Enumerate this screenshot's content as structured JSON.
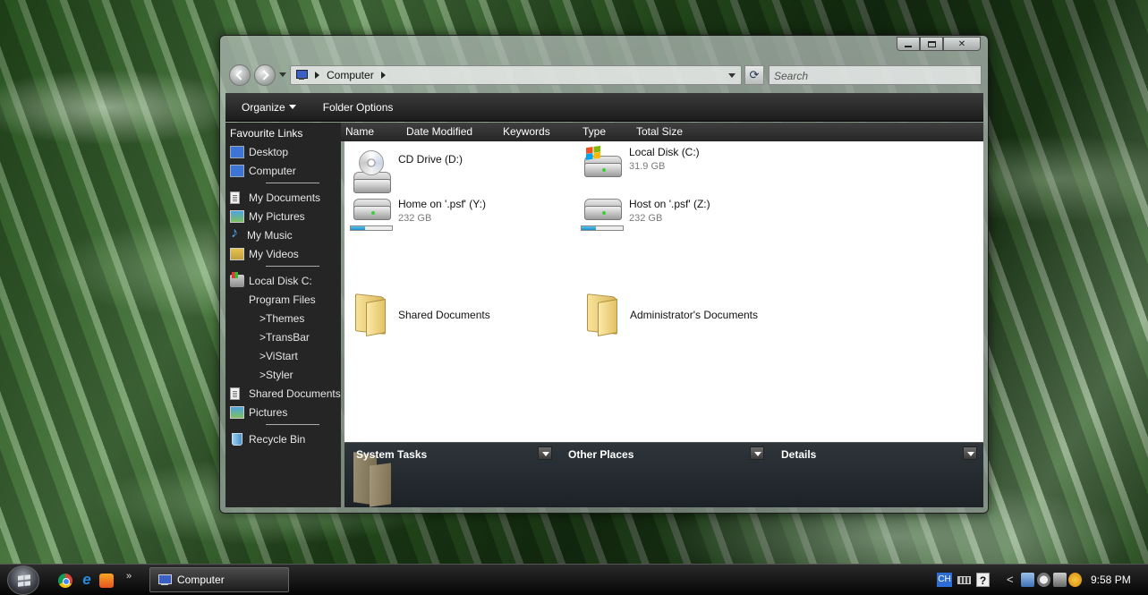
{
  "window": {
    "caption_buttons": [
      "minimize-icon",
      "maximize-icon",
      "close-icon"
    ],
    "close_glyph": "✕"
  },
  "navbar": {
    "address_crumb": "Computer",
    "search_placeholder": "Search",
    "refresh_glyph": "⟳"
  },
  "toolbar": {
    "organize": "Organize",
    "folder_options": "Folder Options"
  },
  "sidebar": {
    "title": "Favourite Links",
    "items": [
      {
        "label": "Desktop",
        "icon": "desktop-icon"
      },
      {
        "label": "Computer",
        "icon": "computer-icon"
      },
      {
        "label": "My Documents",
        "icon": "documents-icon"
      },
      {
        "label": "My Pictures",
        "icon": "pictures-icon"
      },
      {
        "label": "My Music",
        "icon": "music-icon"
      },
      {
        "label": "My Videos",
        "icon": "videos-icon"
      },
      {
        "label": "Local Disk C:",
        "icon": "local-disk-icon"
      },
      {
        "label": "Program Files"
      },
      {
        "label": ">Themes"
      },
      {
        "label": ">TransBar"
      },
      {
        "label": ">ViStart"
      },
      {
        "label": ">Styler"
      },
      {
        "label": "Shared Documents",
        "icon": "documents-icon"
      },
      {
        "label": "Pictures",
        "icon": "pictures-icon"
      },
      {
        "label": "Recycle Bin",
        "icon": "recycle-bin-icon"
      }
    ]
  },
  "columns": [
    "Name",
    "Date Modified",
    "Keywords",
    "Type",
    "Total Size"
  ],
  "items": [
    {
      "name": "CD Drive (D:)",
      "detail": "",
      "icon": "cd-drive-icon"
    },
    {
      "name": "Local Disk (C:)",
      "detail": "31.9 GB",
      "icon": "hard-disk-icon"
    },
    {
      "name": "Home on '.psf' (Y:)",
      "detail": "232 GB",
      "icon": "network-drive-icon",
      "usage": 0.35
    },
    {
      "name": "Host on '.psf' (Z:)",
      "detail": "232 GB",
      "icon": "network-drive-icon",
      "usage": 0.35
    },
    {
      "name": "Shared Documents",
      "detail": "",
      "icon": "folder-icon"
    },
    {
      "name": "Administrator's Documents",
      "detail": "",
      "icon": "folder-icon"
    }
  ],
  "tasks": {
    "system_tasks": "System Tasks",
    "other_places": "Other Places",
    "details": "Details"
  },
  "taskbar": {
    "more_glyph": "»",
    "ie_glyph": "e",
    "task_button": "Computer",
    "lang": "CH",
    "help_glyph": "?",
    "chevron_glyph": "<",
    "clock": "9:58 PM"
  }
}
